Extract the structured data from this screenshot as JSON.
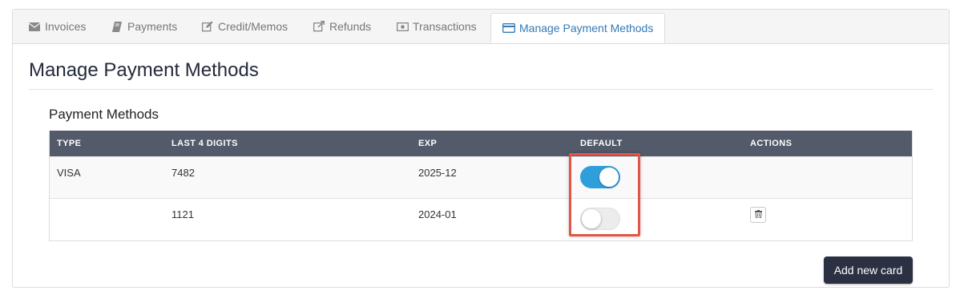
{
  "tabs": [
    {
      "label": "Invoices",
      "icon": "envelope-icon",
      "active": false
    },
    {
      "label": "Payments",
      "icon": "book-icon",
      "active": false
    },
    {
      "label": "Credit/Memos",
      "icon": "edit-icon",
      "active": false
    },
    {
      "label": "Refunds",
      "icon": "external-link-icon",
      "active": false
    },
    {
      "label": "Transactions",
      "icon": "money-icon",
      "active": false
    },
    {
      "label": "Manage Payment Methods",
      "icon": "credit-card-icon",
      "active": true
    }
  ],
  "page_title": "Manage Payment Methods",
  "section_title": "Payment Methods",
  "table": {
    "headers": [
      "TYPE",
      "LAST 4 DIGITS",
      "EXP",
      "DEFAULT",
      "ACTIONS"
    ],
    "rows": [
      {
        "type": "VISA",
        "last4": "7482",
        "exp": "2025-12",
        "default": true,
        "has_delete": false
      },
      {
        "type": "",
        "last4": "1121",
        "exp": "2024-01",
        "default": false,
        "has_delete": true
      }
    ]
  },
  "add_button_label": "Add new card",
  "colors": {
    "accent": "#337ab7",
    "header_bg": "#535a6a",
    "toggle_on": "#2f9fdb",
    "highlight": "#e25548",
    "button_bg": "#2b3142"
  }
}
